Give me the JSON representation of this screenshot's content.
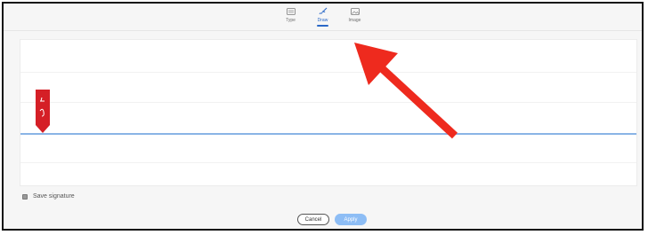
{
  "tabs": [
    {
      "label": "Type",
      "icon": "keyboard-icon",
      "active": false
    },
    {
      "label": "Draw",
      "icon": "pen-scribble-icon",
      "active": true
    },
    {
      "label": "Image",
      "icon": "image-icon",
      "active": false
    }
  ],
  "signature": {
    "save_label": "Save signature",
    "save_checked": true
  },
  "actions": {
    "cancel_label": "Cancel",
    "apply_label": "Apply"
  },
  "colors": {
    "accent": "#2a68c7",
    "signature_line": "#8ab4e6",
    "apply_disabled": "#8dbdf5",
    "marker": "#d51f26",
    "annotation_arrow": "#ee2a1e"
  },
  "annotation": {
    "icon": "red-arrow-icon"
  }
}
